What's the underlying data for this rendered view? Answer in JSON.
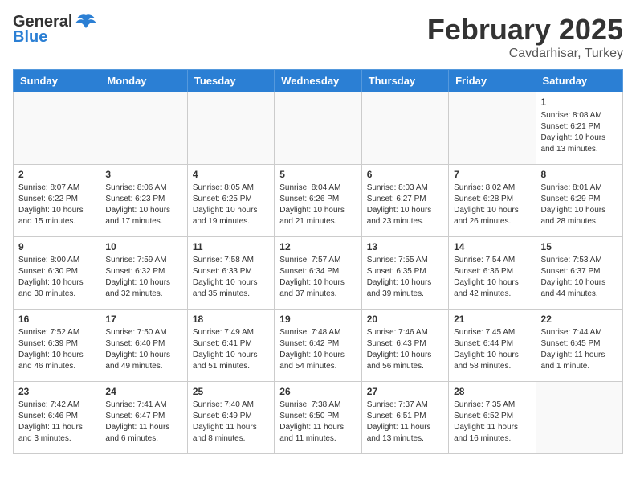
{
  "header": {
    "logo_general": "General",
    "logo_blue": "Blue",
    "month_title": "February 2025",
    "location": "Cavdarhisar, Turkey"
  },
  "calendar": {
    "days_of_week": [
      "Sunday",
      "Monday",
      "Tuesday",
      "Wednesday",
      "Thursday",
      "Friday",
      "Saturday"
    ],
    "weeks": [
      [
        {
          "day": "",
          "info": ""
        },
        {
          "day": "",
          "info": ""
        },
        {
          "day": "",
          "info": ""
        },
        {
          "day": "",
          "info": ""
        },
        {
          "day": "",
          "info": ""
        },
        {
          "day": "",
          "info": ""
        },
        {
          "day": "1",
          "info": "Sunrise: 8:08 AM\nSunset: 6:21 PM\nDaylight: 10 hours and 13 minutes."
        }
      ],
      [
        {
          "day": "2",
          "info": "Sunrise: 8:07 AM\nSunset: 6:22 PM\nDaylight: 10 hours and 15 minutes."
        },
        {
          "day": "3",
          "info": "Sunrise: 8:06 AM\nSunset: 6:23 PM\nDaylight: 10 hours and 17 minutes."
        },
        {
          "day": "4",
          "info": "Sunrise: 8:05 AM\nSunset: 6:25 PM\nDaylight: 10 hours and 19 minutes."
        },
        {
          "day": "5",
          "info": "Sunrise: 8:04 AM\nSunset: 6:26 PM\nDaylight: 10 hours and 21 minutes."
        },
        {
          "day": "6",
          "info": "Sunrise: 8:03 AM\nSunset: 6:27 PM\nDaylight: 10 hours and 23 minutes."
        },
        {
          "day": "7",
          "info": "Sunrise: 8:02 AM\nSunset: 6:28 PM\nDaylight: 10 hours and 26 minutes."
        },
        {
          "day": "8",
          "info": "Sunrise: 8:01 AM\nSunset: 6:29 PM\nDaylight: 10 hours and 28 minutes."
        }
      ],
      [
        {
          "day": "9",
          "info": "Sunrise: 8:00 AM\nSunset: 6:30 PM\nDaylight: 10 hours and 30 minutes."
        },
        {
          "day": "10",
          "info": "Sunrise: 7:59 AM\nSunset: 6:32 PM\nDaylight: 10 hours and 32 minutes."
        },
        {
          "day": "11",
          "info": "Sunrise: 7:58 AM\nSunset: 6:33 PM\nDaylight: 10 hours and 35 minutes."
        },
        {
          "day": "12",
          "info": "Sunrise: 7:57 AM\nSunset: 6:34 PM\nDaylight: 10 hours and 37 minutes."
        },
        {
          "day": "13",
          "info": "Sunrise: 7:55 AM\nSunset: 6:35 PM\nDaylight: 10 hours and 39 minutes."
        },
        {
          "day": "14",
          "info": "Sunrise: 7:54 AM\nSunset: 6:36 PM\nDaylight: 10 hours and 42 minutes."
        },
        {
          "day": "15",
          "info": "Sunrise: 7:53 AM\nSunset: 6:37 PM\nDaylight: 10 hours and 44 minutes."
        }
      ],
      [
        {
          "day": "16",
          "info": "Sunrise: 7:52 AM\nSunset: 6:39 PM\nDaylight: 10 hours and 46 minutes."
        },
        {
          "day": "17",
          "info": "Sunrise: 7:50 AM\nSunset: 6:40 PM\nDaylight: 10 hours and 49 minutes."
        },
        {
          "day": "18",
          "info": "Sunrise: 7:49 AM\nSunset: 6:41 PM\nDaylight: 10 hours and 51 minutes."
        },
        {
          "day": "19",
          "info": "Sunrise: 7:48 AM\nSunset: 6:42 PM\nDaylight: 10 hours and 54 minutes."
        },
        {
          "day": "20",
          "info": "Sunrise: 7:46 AM\nSunset: 6:43 PM\nDaylight: 10 hours and 56 minutes."
        },
        {
          "day": "21",
          "info": "Sunrise: 7:45 AM\nSunset: 6:44 PM\nDaylight: 10 hours and 58 minutes."
        },
        {
          "day": "22",
          "info": "Sunrise: 7:44 AM\nSunset: 6:45 PM\nDaylight: 11 hours and 1 minute."
        }
      ],
      [
        {
          "day": "23",
          "info": "Sunrise: 7:42 AM\nSunset: 6:46 PM\nDaylight: 11 hours and 3 minutes."
        },
        {
          "day": "24",
          "info": "Sunrise: 7:41 AM\nSunset: 6:47 PM\nDaylight: 11 hours and 6 minutes."
        },
        {
          "day": "25",
          "info": "Sunrise: 7:40 AM\nSunset: 6:49 PM\nDaylight: 11 hours and 8 minutes."
        },
        {
          "day": "26",
          "info": "Sunrise: 7:38 AM\nSunset: 6:50 PM\nDaylight: 11 hours and 11 minutes."
        },
        {
          "day": "27",
          "info": "Sunrise: 7:37 AM\nSunset: 6:51 PM\nDaylight: 11 hours and 13 minutes."
        },
        {
          "day": "28",
          "info": "Sunrise: 7:35 AM\nSunset: 6:52 PM\nDaylight: 11 hours and 16 minutes."
        },
        {
          "day": "",
          "info": ""
        }
      ]
    ]
  }
}
